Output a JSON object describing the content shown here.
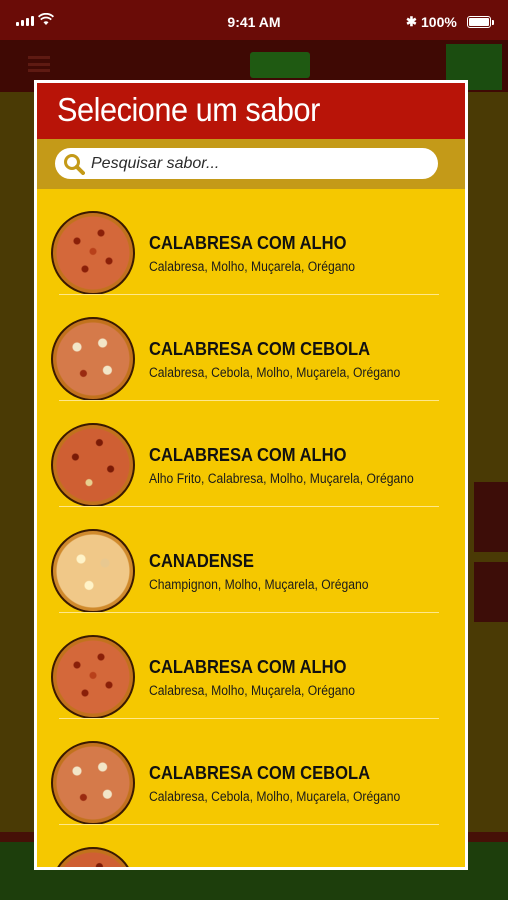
{
  "status_bar": {
    "time": "9:41 AM",
    "battery": "100%",
    "icons": [
      "signal-icon",
      "wifi-icon",
      "bluetooth-icon",
      "battery-icon"
    ]
  },
  "modal": {
    "title": "Selecione um sabor",
    "search": {
      "placeholder": "Pesquisar sabor...",
      "value": ""
    },
    "items": [
      {
        "name": "CALABRESA COM ALHO",
        "ingredients": "Calabresa, Molho, Muçarela, Orégano"
      },
      {
        "name": "CALABRESA COM CEBOLA",
        "ingredients": "Calabresa, Cebola, Molho, Muçarela, Orégano"
      },
      {
        "name": "CALABRESA COM ALHO",
        "ingredients": "Alho Frito, Calabresa, Molho, Muçarela, Orégano"
      },
      {
        "name": "CANADENSE",
        "ingredients": "Champignon, Molho, Muçarela, Orégano"
      },
      {
        "name": "CALABRESA COM ALHO",
        "ingredients": "Calabresa, Molho, Muçarela, Orégano"
      },
      {
        "name": "CALABRESA COM CEBOLA",
        "ingredients": "Calabresa, Cebola, Molho, Muçarela, Orégano"
      },
      {
        "name": "",
        "ingredients": ""
      }
    ]
  },
  "colors": {
    "header_red": "#b81408",
    "modal_yellow": "#f5c800",
    "search_band": "#c49a18",
    "status_bar": "#6a0c07"
  }
}
